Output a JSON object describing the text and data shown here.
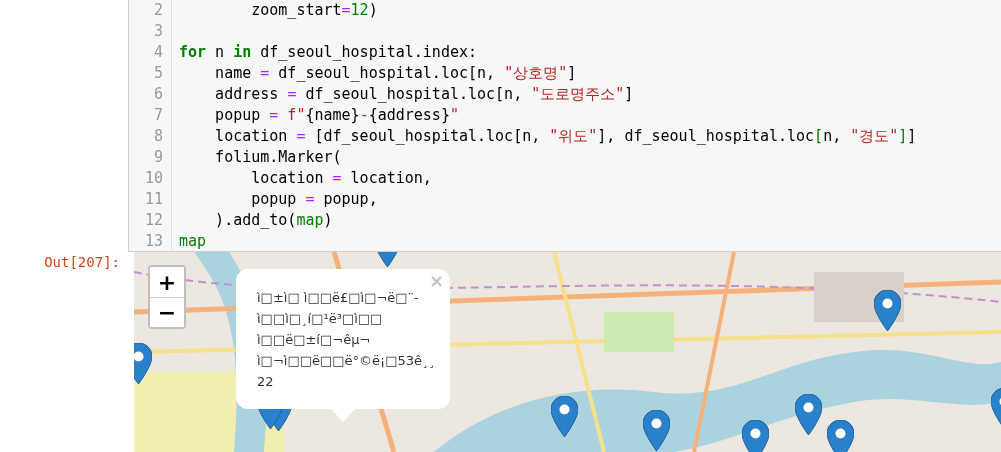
{
  "code_cell": {
    "lines": [
      {
        "number": "2",
        "tokens": [
          {
            "kind": "plain",
            "text": "        zoom_start"
          },
          {
            "kind": "operator",
            "text": "="
          },
          {
            "kind": "number",
            "text": "12"
          },
          {
            "kind": "plain",
            "text": ")"
          }
        ]
      },
      {
        "number": "3"
      },
      {
        "number": "4",
        "tokens": [
          {
            "kind": "keyword",
            "text": "for"
          },
          {
            "kind": "plain",
            "text": " n "
          },
          {
            "kind": "keyword",
            "text": "in"
          },
          {
            "kind": "plain",
            "text": " df_seoul_hospital.index:"
          }
        ]
      },
      {
        "number": "5",
        "tokens": [
          {
            "kind": "plain",
            "text": "    name "
          },
          {
            "kind": "operator",
            "text": "="
          },
          {
            "kind": "plain",
            "text": " df_seoul_hospital.loc[n, "
          },
          {
            "kind": "string",
            "text": "\"상호명\""
          },
          {
            "kind": "plain",
            "text": "]"
          }
        ]
      },
      {
        "number": "6",
        "tokens": [
          {
            "kind": "plain",
            "text": "    address "
          },
          {
            "kind": "operator",
            "text": "="
          },
          {
            "kind": "plain",
            "text": " df_seoul_hospital.loc[n, "
          },
          {
            "kind": "string",
            "text": "\"도로명주소\""
          },
          {
            "kind": "plain",
            "text": "]"
          }
        ]
      },
      {
        "number": "7",
        "tokens": [
          {
            "kind": "plain",
            "text": "    popup "
          },
          {
            "kind": "operator",
            "text": "="
          },
          {
            "kind": "string",
            "text": " f\""
          },
          {
            "kind": "plain",
            "text": "{name}"
          },
          {
            "kind": "string",
            "text": "-"
          },
          {
            "kind": "plain",
            "text": "{address}"
          },
          {
            "kind": "string",
            "text": "\""
          }
        ]
      },
      {
        "number": "8",
        "tokens": [
          {
            "kind": "plain",
            "text": "    location "
          },
          {
            "kind": "operator",
            "text": "="
          },
          {
            "kind": "plain",
            "text": " [df_seoul_hospital.loc[n, "
          },
          {
            "kind": "string",
            "text": "\"위도\""
          },
          {
            "kind": "plain",
            "text": "], df_seoul_hospital.loc"
          },
          {
            "kind": "bracket",
            "text": "["
          },
          {
            "kind": "plain",
            "text": "n, "
          },
          {
            "kind": "string",
            "text": "\"경도\""
          },
          {
            "kind": "bracket",
            "text": "]"
          },
          {
            "kind": "plain",
            "text": "]"
          }
        ]
      },
      {
        "number": "9",
        "tokens": [
          {
            "kind": "plain",
            "text": "    folium.Marker("
          }
        ]
      },
      {
        "number": "10",
        "tokens": [
          {
            "kind": "plain",
            "text": "        location "
          },
          {
            "kind": "operator",
            "text": "="
          },
          {
            "kind": "plain",
            "text": " location,"
          }
        ]
      },
      {
        "number": "11",
        "tokens": [
          {
            "kind": "plain",
            "text": "        popup "
          },
          {
            "kind": "operator",
            "text": "="
          },
          {
            "kind": "plain",
            "text": " popup,"
          }
        ]
      },
      {
        "number": "12",
        "tokens": [
          {
            "kind": "plain",
            "text": "    ).add_to("
          },
          {
            "kind": "builtin",
            "text": "map"
          },
          {
            "kind": "plain",
            "text": ")"
          }
        ]
      },
      {
        "number": "13",
        "tokens": [
          {
            "kind": "builtin",
            "text": "map"
          }
        ]
      }
    ]
  },
  "output": {
    "prompt": "Out[207]:",
    "map": {
      "zoom_in": "+",
      "zoom_out": "−",
      "popup": {
        "close": "×",
        "lines": [
          "ì□±ì□ ì□□ë£□ì□¬ë□¨-",
          "ì□□ì□¸í□¹ë³□ì□□",
          "ì□□ë□±í□¬êµ¬",
          "ì□¬ì□□ë□□ë°©ë¡□53ê¸¸",
          "22"
        ]
      }
    }
  }
}
